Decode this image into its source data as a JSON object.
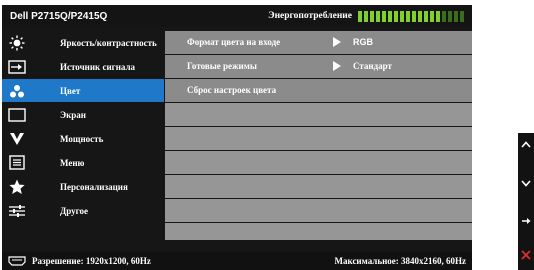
{
  "titlebar": {
    "title": "Dell P2715Q/P2415Q",
    "energy_label": "Энергопотребление",
    "energy_level": 0.78
  },
  "menu": {
    "items": [
      {
        "label": "Яркость/контрастность",
        "icon": "brightness-icon"
      },
      {
        "label": "Источник сигнала",
        "icon": "input-source-icon"
      },
      {
        "label": "Цвет",
        "icon": "color-icon",
        "active": true
      },
      {
        "label": "Экран",
        "icon": "display-icon"
      },
      {
        "label": "Мощность",
        "icon": "power-icon"
      },
      {
        "label": "Меню",
        "icon": "menu-icon"
      },
      {
        "label": "Персонализация",
        "icon": "star-icon"
      },
      {
        "label": "Другое",
        "icon": "sliders-icon"
      }
    ]
  },
  "panel": {
    "rows": [
      {
        "name": "Формат цвета на входе",
        "value": "RGB"
      },
      {
        "name": "Готовые режимы",
        "value": "Стандарт"
      },
      {
        "name": "Сброс настроек цвета",
        "value": ""
      }
    ]
  },
  "status": {
    "resolution": "Разрешение: 1920x1200, 60Hz",
    "max_resolution": "Максимальное: 3840x2160, 60Hz"
  },
  "colors": {
    "accent": "#1f78c8",
    "row": "#8b8b8b",
    "meter_on": "#7fcf2f",
    "close": "#d9302c"
  }
}
